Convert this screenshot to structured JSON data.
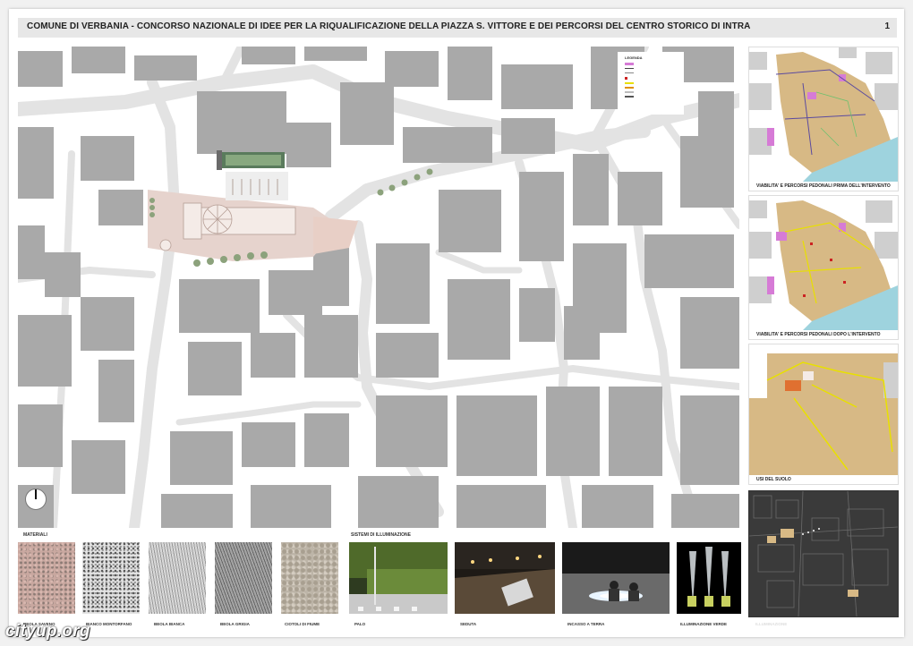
{
  "header": {
    "title": "COMUNE DI VERBANIA - CONCORSO NAZIONALE DI IDEE PER LA RIQUALIFICAZIONE DELLA PIAZZA S. VITTORE E DEI PERCORSI DEL CENTRO STORICO DI INTRA",
    "page_number": "1"
  },
  "legend": {
    "title": "LEGENDA"
  },
  "thumbnails": [
    {
      "caption": "VIABILITA' E PERCORSI PEDONALI PRIMA DELL'INTERVENTO"
    },
    {
      "caption": "VIABILITA' E PERCORSI PEDONALI DOPO L'INTERVENTO"
    },
    {
      "caption": "USI DEL SUOLO"
    },
    {
      "caption": "ILLUMINAZIONE"
    }
  ],
  "materials": {
    "label": "MATERIALI",
    "items": [
      {
        "caption": "BEOLA SAVENO",
        "color": "#c9a8a0"
      },
      {
        "caption": "BIANCO MONTORFANO",
        "color": "#d9d9d9"
      },
      {
        "caption": "BEOLA BIANCA",
        "color": "#c4c4c4"
      },
      {
        "caption": "BEOLA GRIGIA",
        "color": "#8e8e8e"
      },
      {
        "caption": "CIOTOLI DI FIUME",
        "color": "#bdb5a8"
      }
    ]
  },
  "lighting": {
    "label": "SISTEMI DI ILLUMINAZIONE",
    "items": [
      {
        "caption": "PALO"
      },
      {
        "caption": "SEDUTA"
      },
      {
        "caption": "INCASSO A TERRA"
      },
      {
        "caption": "ILLUMINAZIONE VERDE"
      }
    ]
  },
  "colors": {
    "building": "#a9a9a9",
    "street": "#e3e3e3",
    "piazza": "#e6d3cd",
    "land_use": "#d7b985",
    "lake": "#9ed3de",
    "pedestrian": "#d67bd6"
  },
  "watermark": "cityup.org"
}
